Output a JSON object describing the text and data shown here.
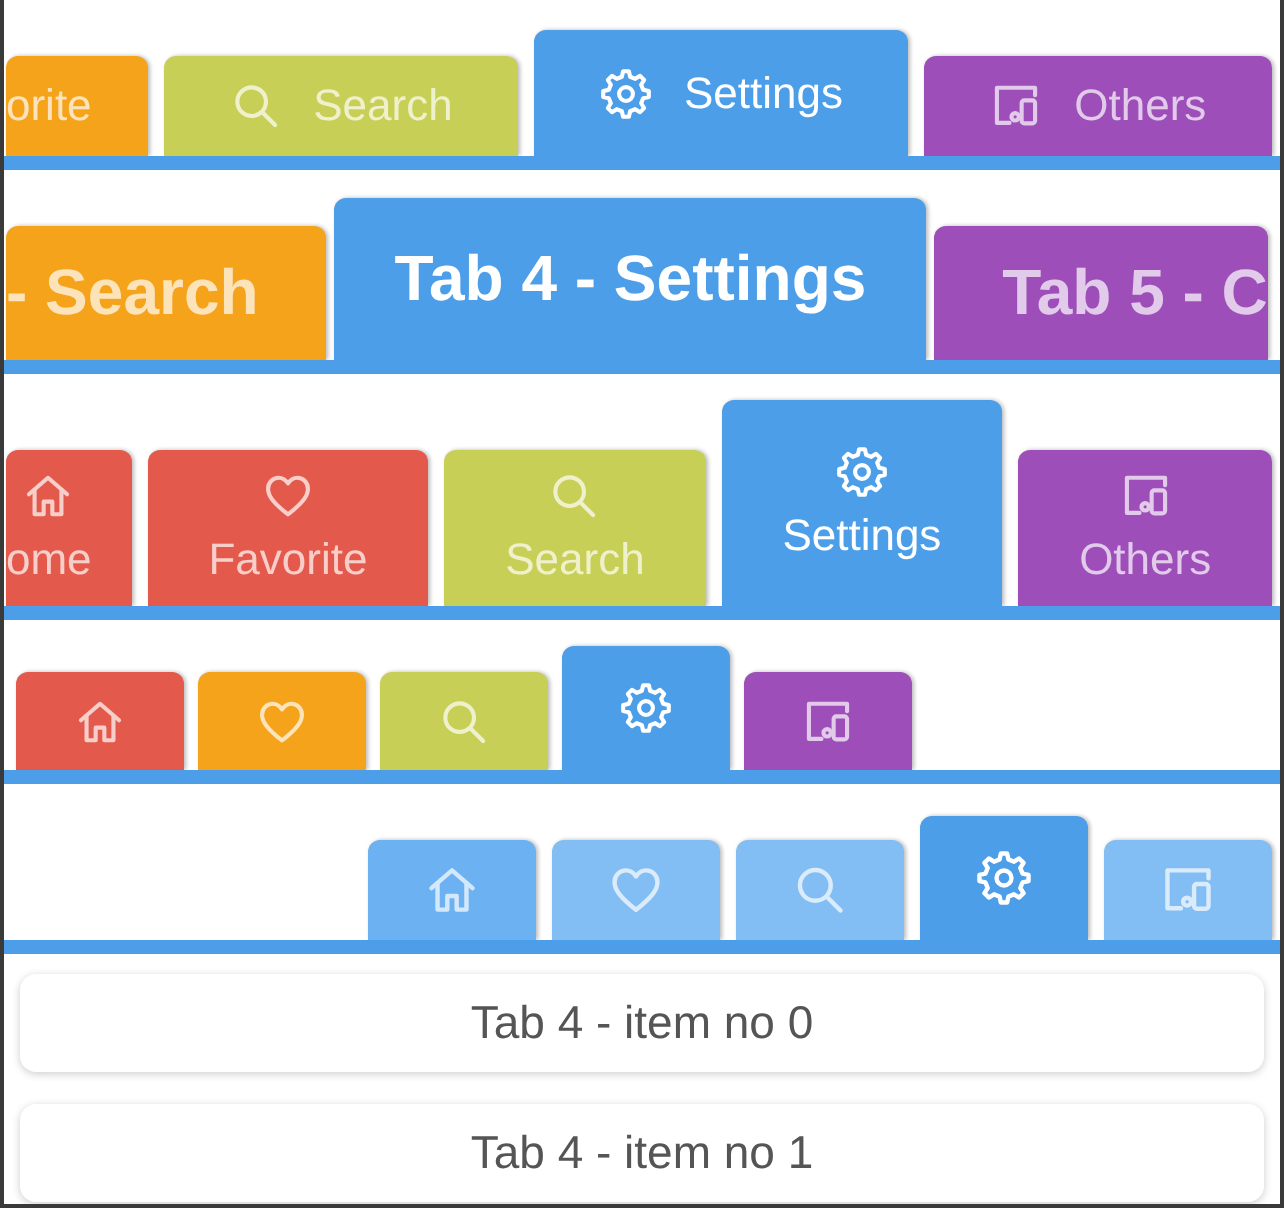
{
  "tab_bars": [
    {
      "kind": "inline",
      "tabs": [
        {
          "label": "orite",
          "selected": false,
          "color": "#f5a31a"
        },
        {
          "kind": "search",
          "label": "Search",
          "selected": false,
          "color": "#c8cf56"
        },
        {
          "kind": "settings",
          "label": "Settings",
          "selected": true,
          "color": "#4c9ee8"
        },
        {
          "kind": "others",
          "label": "Others",
          "selected": false,
          "color": "#9d4eb9"
        }
      ]
    },
    {
      "kind": "large",
      "tabs": [
        {
          "label": "- Search",
          "selected": false,
          "color": "#f5a31a"
        },
        {
          "label": "Tab 4 - Settings",
          "selected": true,
          "color": "#4c9ee8"
        },
        {
          "label": "Tab 5 - C",
          "selected": false,
          "color": "#9d4eb9"
        }
      ]
    },
    {
      "kind": "stacked",
      "tabs": [
        {
          "kind": "home",
          "label": "ome",
          "selected": false,
          "color": "#e35a4c"
        },
        {
          "kind": "favorite",
          "label": "Favorite",
          "selected": false,
          "color": "#e35a4c"
        },
        {
          "kind": "search",
          "label": "Search",
          "selected": false,
          "color": "#c8cf56"
        },
        {
          "kind": "settings",
          "label": "Settings",
          "selected": true,
          "color": "#4c9ee8"
        },
        {
          "kind": "others",
          "label": "Others",
          "selected": false,
          "color": "#9d4eb9"
        }
      ]
    },
    {
      "kind": "compact",
      "tabs": [
        {
          "kind": "home",
          "selected": false,
          "color": "#e35a4c"
        },
        {
          "kind": "favorite",
          "selected": false,
          "color": "#f5a31a"
        },
        {
          "kind": "search",
          "selected": false,
          "color": "#c8cf56"
        },
        {
          "kind": "settings",
          "selected": true,
          "color": "#4c9ee8"
        },
        {
          "kind": "others",
          "selected": false,
          "color": "#9d4eb9"
        }
      ]
    },
    {
      "kind": "trailing",
      "tabs": [
        {
          "kind": "home",
          "selected": false,
          "color": "#6cb2f2"
        },
        {
          "kind": "favorite",
          "selected": false,
          "color": "#82bdf3"
        },
        {
          "kind": "search",
          "selected": false,
          "color": "#82bdf3"
        },
        {
          "kind": "settings",
          "selected": true,
          "color": "#4c9ee8"
        },
        {
          "kind": "others",
          "selected": false,
          "color": "#82bdf3"
        }
      ]
    }
  ],
  "list_items": [
    "Tab 4 - item no 0",
    "Tab 4 - item no 1"
  ]
}
